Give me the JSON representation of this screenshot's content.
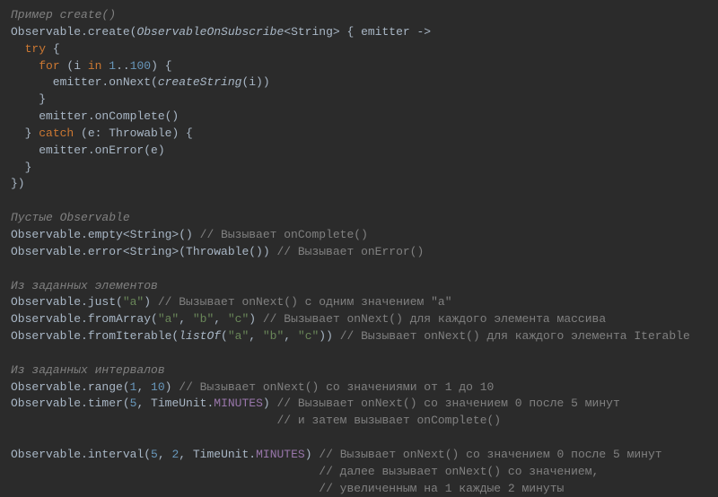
{
  "sec1": {
    "title": "Пример create()",
    "l1": {
      "a": "Observable.create(",
      "b": "ObservableOnSubscribe",
      "c": "<String> { emitter ->"
    },
    "l2": {
      "a": "  ",
      "b": "try",
      "c": " {"
    },
    "l3": {
      "a": "    ",
      "b": "for",
      "c": " (i ",
      "d": "in",
      "e": " ",
      "f": "1",
      "g": "..",
      "h": "100",
      "i": ") {"
    },
    "l4": {
      "a": "      emitter.onNext(",
      "b": "createString",
      "c": "(i))"
    },
    "l5": "    }",
    "l6": "    emitter.onComplete()",
    "l7": {
      "a": "  } ",
      "b": "catch",
      "c": " (e: Throwable) {"
    },
    "l8": "    emitter.onError(e)",
    "l9": "  }",
    "l10": "})"
  },
  "sec2": {
    "title": "Пустые Observable",
    "l1": {
      "a": "Observable.empty<String>() ",
      "b": "// Вызывает onComplete()"
    },
    "l2": {
      "a": "Observable.error<String>(Throwable()) ",
      "b": "// Вызывает onError()"
    }
  },
  "sec3": {
    "title": "Из заданных элементов",
    "l1": {
      "a": "Observable.just(",
      "b": "\"a\"",
      "c": ") ",
      "d": "// Вызывает onNext() с одним значением \"a\""
    },
    "l2": {
      "a": "Observable.fromArray(",
      "b": "\"a\"",
      "c": ", ",
      "d": "\"b\"",
      "e": ", ",
      "f": "\"c\"",
      "g": ") ",
      "h": "// Вызывает onNext() для каждого элемента массива"
    },
    "l3": {
      "a": "Observable.fromIterable(",
      "b": "listOf",
      "c": "(",
      "d": "\"a\"",
      "e": ", ",
      "f": "\"b\"",
      "g": ", ",
      "h": "\"c\"",
      "i": ")) ",
      "j": "// Вызывает onNext() для каждого элемента Iterable"
    }
  },
  "sec4": {
    "title": "Из заданных интервалов",
    "l1": {
      "a": "Observable.range(",
      "b": "1",
      "c": ", ",
      "d": "10",
      "e": ") ",
      "f": "// Вызывает onNext() со значениями от 1 до 10"
    },
    "l2": {
      "a": "Observable.timer(",
      "b": "5",
      "c": ", TimeUnit.",
      "d": "MINUTES",
      "e": ") ",
      "f": "// Вызывает onNext() со значением 0 после 5 минут"
    },
    "l3": {
      "a": "                                      ",
      "b": "// и затем вызывает onComplete()"
    }
  },
  "sec5": {
    "l1": {
      "a": "Observable.interval(",
      "b": "5",
      "c": ", ",
      "d": "2",
      "e": ", TimeUnit.",
      "f": "MINUTES",
      "g": ") ",
      "h": "// Вызывает onNext() со значением 0 после 5 минут"
    },
    "l2": {
      "a": "                                            ",
      "b": "// далее вызывает onNext() со значением,"
    },
    "l3": {
      "a": "                                            ",
      "b": "// увеличенным на 1 каждые 2 минуты"
    }
  }
}
